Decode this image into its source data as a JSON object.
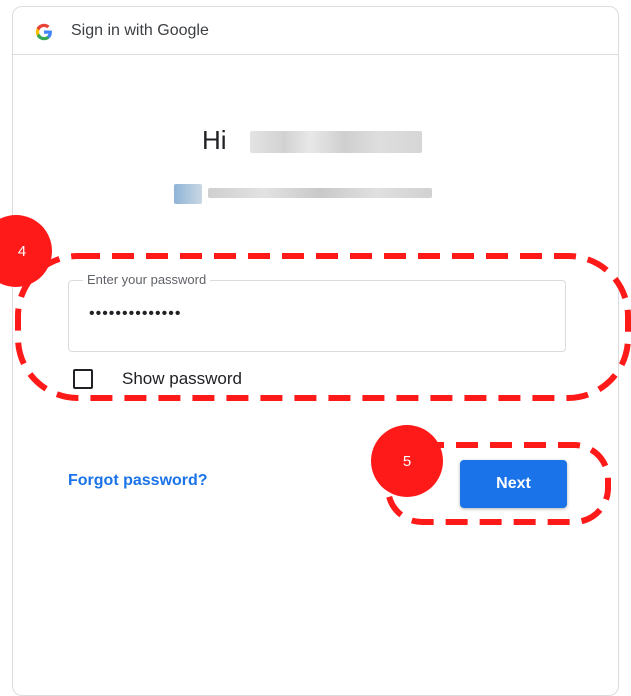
{
  "header": {
    "title": "Sign in with Google",
    "logo_icon": "google-g-icon"
  },
  "account": {
    "greeting": "Hi"
  },
  "password_field": {
    "label": "Enter your password",
    "value": "••••••••••••••"
  },
  "show_password": {
    "label": "Show password",
    "checked": false
  },
  "links": {
    "forgot_password": "Forgot password?"
  },
  "buttons": {
    "next": "Next"
  },
  "annotations": {
    "step_4": "4",
    "step_5": "5",
    "color": "#ff1a1a"
  },
  "colors": {
    "accent": "#1a73e8",
    "border": "#dadce0"
  }
}
